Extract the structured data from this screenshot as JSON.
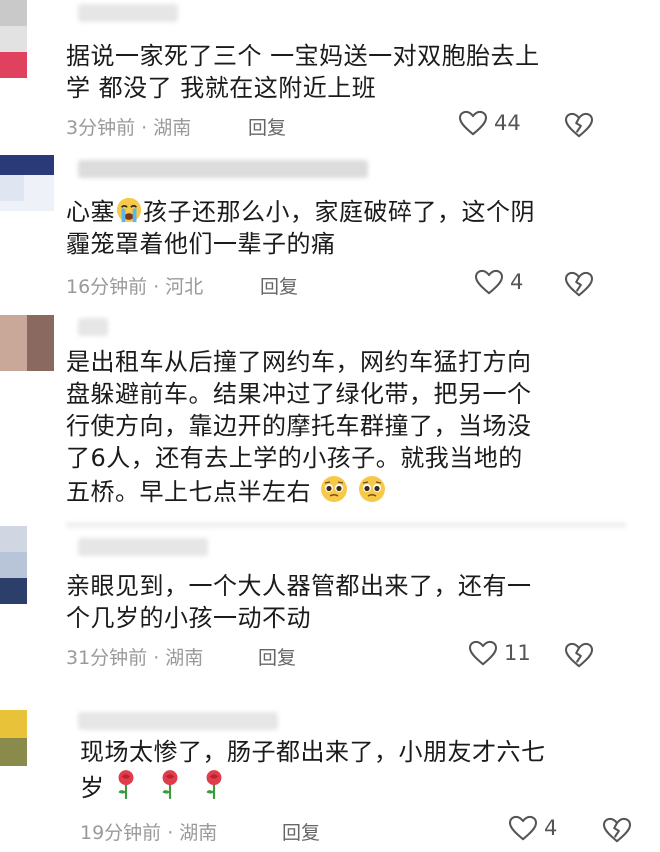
{
  "comments": [
    {
      "text_lines": [
        "据说一家死了三个 一宝妈送一对双胞胎去上",
        "学 都没了 我就在这附近上班"
      ],
      "time_location": "3分钟前 · 湖南",
      "reply_label": "回复",
      "like_count": "44"
    },
    {
      "text_before_emoji": "心塞",
      "text_after_emoji": "孩子还那么小，家庭破碎了，这个阴",
      "text_line2": "霾笼罩着他们一辈子的痛",
      "time_location": "16分钟前 · 河北",
      "reply_label": "回复",
      "like_count": "4"
    },
    {
      "text_lines": [
        "是出租车从后撞了网约车，网约车猛打方向",
        "盘躲避前车。结果冲过了绿化带，把另一个",
        "行使方向，靠边开的摩托车群撞了，当场没",
        "了6人，还有去上学的小孩子。就我当地的"
      ],
      "text_last_line": "五桥。早上七点半左右"
    },
    {
      "text_lines": [
        "亲眼见到，一个大人器管都出来了，还有一",
        "个几岁的小孩一动不动"
      ],
      "time_location": "31分钟前 · 湖南",
      "reply_label": "回复",
      "like_count": "11"
    },
    {
      "text_lines": [
        "现场太惨了，肠子都出来了，小朋友才六七"
      ],
      "text_last_line": "岁",
      "time_location": "19分钟前 · 湖南",
      "reply_label": "回复",
      "like_count": "4"
    }
  ],
  "icons": {
    "like": "heart-outline-icon",
    "dislike": "broken-heart-icon",
    "cry": "crying-face-emoji",
    "pleading": "pleading-face-emoji",
    "rose": "rose-emoji"
  },
  "colors": {
    "text": "#1b1b1b",
    "meta": "#9a9a9a",
    "icon": "#555555"
  }
}
